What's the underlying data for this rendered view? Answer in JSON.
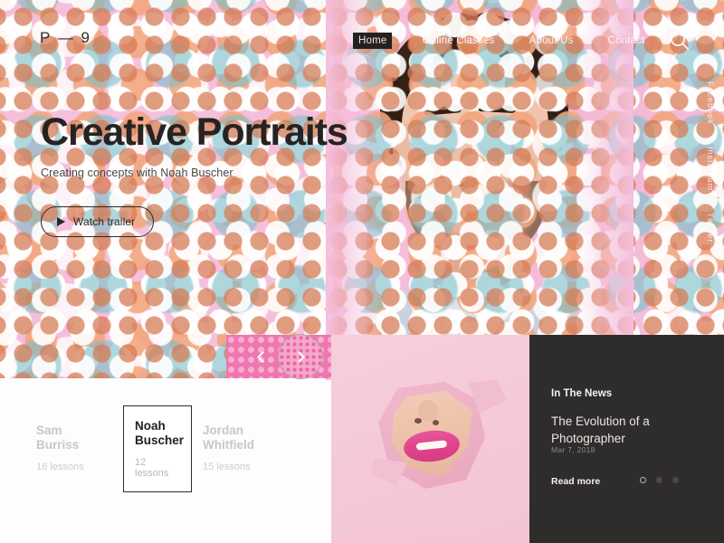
{
  "site": {
    "logo": "P — 9"
  },
  "header": {
    "nav": [
      {
        "label": "Home",
        "active": true
      },
      {
        "label": "Online Classes",
        "active": false
      },
      {
        "label": "About Us",
        "active": false
      },
      {
        "label": "Contact",
        "active": false
      }
    ],
    "search_icon": "search-icon"
  },
  "hero": {
    "title": "Creative Portraits",
    "subtitle": "Creating concepts with Noah Buscher",
    "cta_label": "Watch trailer",
    "cta_icon": "play-icon"
  },
  "social": {
    "links": [
      {
        "label": "Facebook"
      },
      {
        "label": "Instagram"
      },
      {
        "label": "Twitter"
      }
    ]
  },
  "slider": {
    "prev_icon": "chevron-left-icon",
    "next_icon": "chevron-right-icon"
  },
  "instructors": [
    {
      "first": "Sam",
      "last": "Burriss",
      "lessons": "16 lessons",
      "active": false
    },
    {
      "first": "Noah",
      "last": "Buscher",
      "lessons": "12 lessons",
      "active": true
    },
    {
      "first": "Jordan",
      "last": "Whitfield",
      "lessons": "15 lessons",
      "active": false
    }
  ],
  "news": {
    "kicker": "In The News",
    "headline": "The Evolution of a Photographer",
    "date": "Mar 7, 2018",
    "read_more": "Read more",
    "dots": [
      {
        "active": true
      },
      {
        "active": false
      },
      {
        "active": false
      }
    ]
  },
  "colors": {
    "pink_bg": "#f4bedb",
    "hot_pink": "#ef76b0",
    "dark_panel": "#2f2d2c",
    "white_panel": "#fdfdfd",
    "text_dark": "#262322",
    "text_muted": "#c9c7c9"
  }
}
